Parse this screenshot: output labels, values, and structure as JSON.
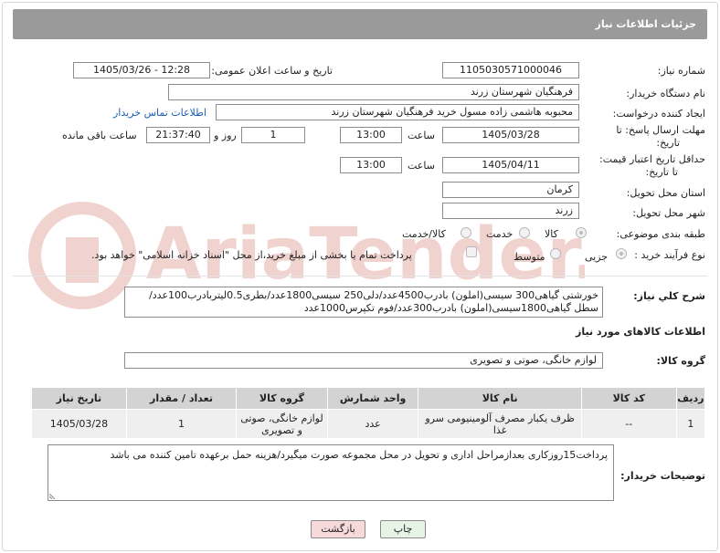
{
  "header": {
    "title": "جزئیات اطلاعات نیاز"
  },
  "fields": {
    "need_number": {
      "label": "شماره نیاز:",
      "value": "1105030571000046"
    },
    "announce_datetime": {
      "label": "تاریخ و ساعت اعلان عمومی:",
      "value": "1405/03/26 - 12:28"
    },
    "buyer_org": {
      "label": "نام دستگاه خریدار:",
      "value": "فرهنگیان شهرستان زرند"
    },
    "requester": {
      "label": "ایجاد کننده درخواست:",
      "value": "محبوبه هاشمی زاده مسول خرید فرهنگیان شهرستان زرند",
      "contact_link": "اطلاعات تماس خریدار"
    },
    "response_deadline": {
      "label_line1": "مهلت ارسال پاسخ: تا",
      "label_line2": "تاریخ:",
      "date": "1405/03/28",
      "time_label": "ساعت",
      "time": "13:00",
      "days": "1",
      "days_label": "روز و",
      "remaining": "21:37:40",
      "remaining_label": "ساعت باقی مانده"
    },
    "price_validity": {
      "label_line1": "حداقل تاریخ اعتبار قیمت:",
      "label_line2": "تا تاریخ:",
      "date": "1405/04/11",
      "time_label": "ساعت",
      "time": "13:00"
    },
    "province": {
      "label": "استان محل تحویل:",
      "value": "کرمان"
    },
    "city": {
      "label": "شهر محل تحویل:",
      "value": "زرند"
    },
    "category": {
      "label": "طبقه بندی موضوعی:",
      "options": [
        "کالا",
        "خدمت",
        "کالا/خدمت"
      ],
      "selected": "کالا"
    },
    "process": {
      "label": "نوع فرآیند خرید :",
      "options": [
        "جزیی",
        "متوسط"
      ],
      "selected": "جزیی",
      "payment_note": "پرداخت تمام یا بخشی از مبلغ خرید،از محل \"اسناد خزانه اسلامی\" خواهد بود."
    }
  },
  "watermark": {
    "text": "AriaTender.neT"
  },
  "general_desc": {
    "label": "شرح کلي نياز:",
    "value": "خورشتی گیاهی300 سیسی(املون) بادرب4500عدد/دلی250 سیسی1800عدد/بطری0.5لیتربادرب100عدد/سطل گیاهی1800سیسی(املون) بادرب300عدد/فوم تکپرس1000عدد"
  },
  "goods_section": {
    "title": "اطلاعات کالاهای مورد نیاز"
  },
  "goods_group": {
    "label": "گروه کالا:",
    "value": "لوازم خانگی، صوتی و تصویری"
  },
  "table": {
    "headers": [
      "ردیف",
      "کد کالا",
      "نام کالا",
      "واحد شمارش",
      "گروه کالا",
      "تعداد / مقدار",
      "تاریخ نیاز"
    ],
    "rows": [
      [
        "1",
        "--",
        "ظرف یکبار مصرف آلومینیومی سرو غذا",
        "عدد",
        "لوازم خانگی، صوتی و تصویری",
        "1",
        "1405/03/28"
      ]
    ]
  },
  "buyer_notes": {
    "label": "توضیحات خریدار:",
    "value": "پرداخت15روزکاری بعدازمراحل اداری و تحویل در محل مجموعه صورت میگیرد/هزینه حمل برعهده تامین کننده می باشد"
  },
  "buttons": {
    "print": "چاپ",
    "back": "بازگشت"
  },
  "colors": {
    "header_bg": "#9a9a9a",
    "link": "#1a5fb4",
    "back_btn_bg": "#f7d9d9",
    "print_btn_bg": "#e6f4e6"
  }
}
